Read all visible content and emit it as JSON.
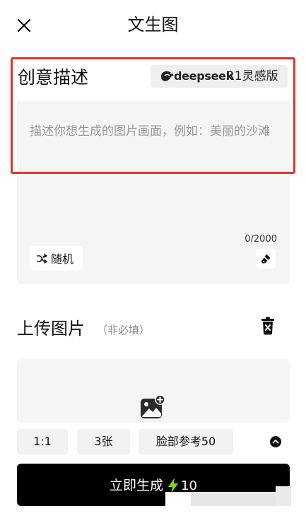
{
  "header": {
    "title": "文生图",
    "close_icon": "close-icon"
  },
  "prompt": {
    "title": "创意描述",
    "model_badge": {
      "brand": "deepseek",
      "model": "R1灵感版",
      "icon": "deepseek-whale-icon",
      "brand_color": "#222222"
    },
    "placeholder": "描述你想生成的图片画面，例如：美丽的沙滩",
    "char_count": "0/2000",
    "random_button": {
      "icon": "shuffle-icon",
      "label": "随机"
    },
    "erase_icon": "eraser-icon"
  },
  "upload": {
    "title": "上传图片",
    "hint": "（非必填）",
    "delete_icon": "trash-icon",
    "add_icon": "add-image-icon"
  },
  "options": {
    "ratio": "1:1",
    "count": "3张",
    "face_reference": "脸部参考50",
    "collapse_icon": "chevron-up-circle-icon"
  },
  "generate": {
    "label": "立即生成",
    "cost": "10",
    "bolt_icon": "lightning-icon",
    "bolt_color": "#7ed321"
  },
  "colors": {
    "highlight": "#e0342c",
    "panel_bg": "#f5f5f5",
    "primary_button": "#000000"
  }
}
